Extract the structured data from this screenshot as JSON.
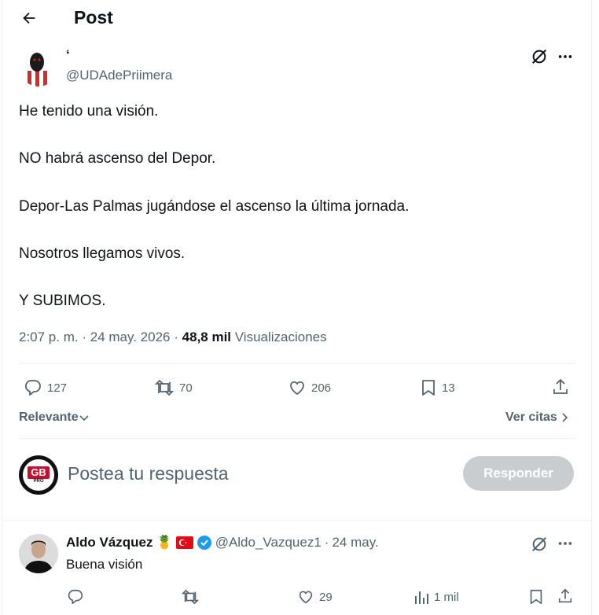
{
  "header": {
    "title": "Post"
  },
  "post": {
    "display_name": "‘",
    "handle": "@UDAdePriimera",
    "lines": [
      "He tenido una visión.",
      "NO habrá ascenso del Depor.",
      "Depor-Las Palmas jugándose el ascenso la última jornada.",
      "Nosotros llegamos vivos.",
      "Y SUBIMOS."
    ],
    "time": "2:07 p. m.",
    "date": "24 may. 2026",
    "separator": "·",
    "views_count": "48,8 mil",
    "views_label": "Visualizaciones",
    "actions": {
      "replies": "127",
      "reposts": "70",
      "likes": "206",
      "bookmarks": "13"
    }
  },
  "sort": {
    "label": "Relevante",
    "quotes_link": "Ver citas"
  },
  "composer": {
    "placeholder": "Postea tu respuesta",
    "button": "Responder",
    "avatar_text": "GB",
    "avatar_subtext": "PRO"
  },
  "reply": {
    "name": "Aldo Vázquez",
    "emoji": "🍍",
    "handle": "@Aldo_Vazquez1",
    "date": "24 may.",
    "text": "Buena visión",
    "likes": "29",
    "views": "1 mil"
  },
  "colors": {
    "accent": "#1d9bf0",
    "muted": "#536471",
    "button_disabled": "#c9cdd0",
    "flag_red": "#e30a17"
  },
  "icons": [
    "back-arrow-icon",
    "grok-icon",
    "more-icon",
    "reply-icon",
    "repost-icon",
    "like-icon",
    "bookmark-icon",
    "share-icon",
    "chevron-down-icon",
    "chevron-right-icon",
    "verified-badge-icon",
    "views-icon",
    "flag-icon"
  ]
}
